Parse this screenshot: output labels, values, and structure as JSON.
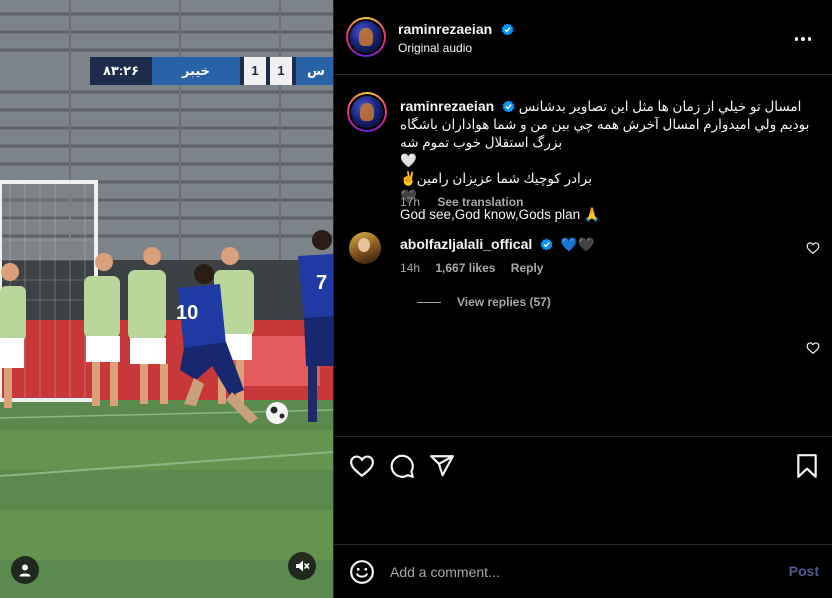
{
  "video": {
    "scorebar": {
      "time": "۸۳:۲۶",
      "team_home": "خیبر",
      "score_home": "1",
      "score_away": "1",
      "team_away": "س"
    },
    "player_number_front": "10",
    "player_number_back": "7",
    "icons": {
      "user_tag": "person-icon",
      "mute": "speaker-muted-icon"
    }
  },
  "post": {
    "author": {
      "username": "raminrezaeian",
      "verified": true,
      "audio": "Original audio"
    },
    "caption": {
      "username": "raminrezaeian",
      "lines": [
        "امسال تو خيلي از زمان ها مثل اين تصاوير بدشانس",
        "بوديم ولي اميدوارم امسال آخرش همه چي بين من و شما هواداران باشگاه",
        "بزرگ استقلال خوب تموم شه🤍",
        "برادر كوچيك شما عزيزان رامين✌️🖤",
        "God see,God know,Gods plan 🙏"
      ],
      "time": "17h",
      "see_translation": "See translation"
    },
    "comment": {
      "username": "abolfazljalali_offical",
      "verified": true,
      "text": "💙🖤",
      "time": "14h",
      "likes": "1,667 likes",
      "reply": "Reply",
      "view_replies": "View replies (57)"
    },
    "add_comment": {
      "placeholder": "Add a comment...",
      "post_label": "Post"
    }
  },
  "colors": {
    "verified_blue": "#0095f6",
    "muted_text": "#a8a8a8",
    "post_disabled": "#4f5b8a"
  }
}
